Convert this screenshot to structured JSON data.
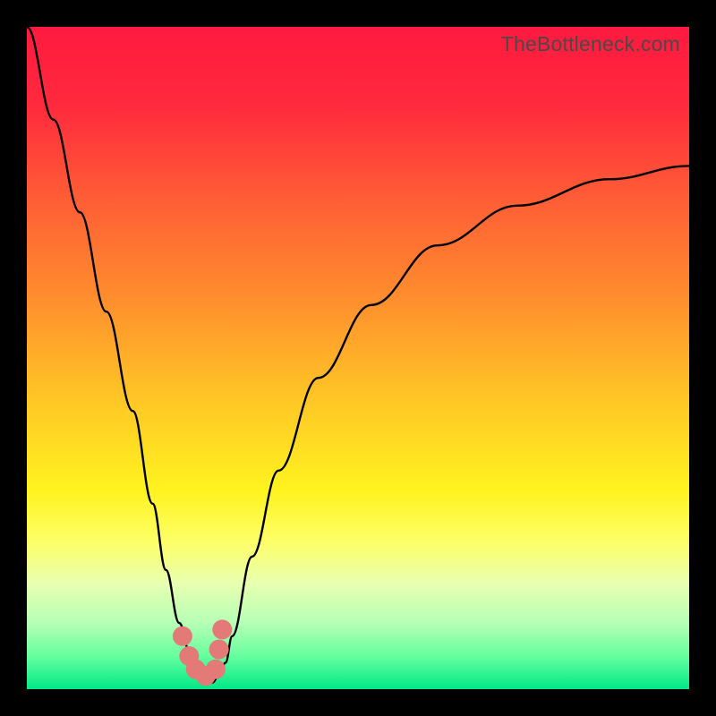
{
  "watermark": "TheBottleneck.com",
  "chart_data": {
    "type": "line",
    "title": "",
    "xlabel": "",
    "ylabel": "",
    "xlim": [
      0,
      100
    ],
    "ylim": [
      0,
      100
    ],
    "series": [
      {
        "name": "bottleneck-curve",
        "x": [
          0,
          4,
          8,
          12,
          16,
          19,
          21,
          23,
          25,
          26,
          27,
          28,
          29,
          30,
          31,
          34,
          38,
          44,
          52,
          62,
          74,
          88,
          100
        ],
        "values": [
          100,
          86,
          72,
          57,
          42,
          28,
          18,
          10,
          4,
          2,
          1,
          1,
          2,
          4,
          8,
          20,
          33,
          47,
          58,
          67,
          73,
          77,
          79
        ]
      }
    ],
    "markers": {
      "name": "highlight-dots",
      "x": [
        23.5,
        24.5,
        25.5,
        27.0,
        28.5,
        29.0,
        29.5
      ],
      "values": [
        8.0,
        5.0,
        3.0,
        2.0,
        3.0,
        6.0,
        9.0
      ]
    },
    "gradient_stops": [
      {
        "offset": 0,
        "color": "#ff1a3f"
      },
      {
        "offset": 12,
        "color": "#ff2a3d"
      },
      {
        "offset": 25,
        "color": "#ff5a36"
      },
      {
        "offset": 40,
        "color": "#ff8a2e"
      },
      {
        "offset": 55,
        "color": "#ffc226"
      },
      {
        "offset": 70,
        "color": "#fff31f"
      },
      {
        "offset": 78,
        "color": "#fdff6a"
      },
      {
        "offset": 84,
        "color": "#e8ffb0"
      },
      {
        "offset": 90,
        "color": "#b6ffb6"
      },
      {
        "offset": 95,
        "color": "#66ff9e"
      },
      {
        "offset": 100,
        "color": "#00e887"
      }
    ],
    "marker_color": "#e47a78",
    "curve_color": "#000000"
  }
}
